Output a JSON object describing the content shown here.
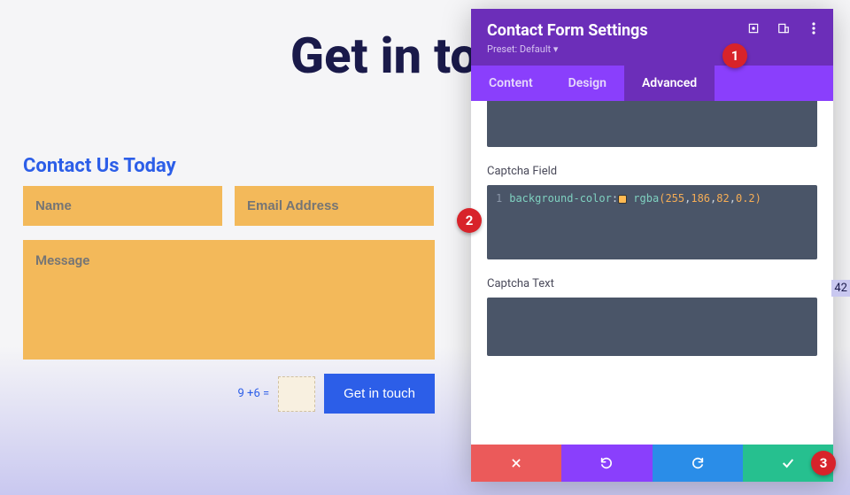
{
  "page": {
    "title": "Get in touch",
    "contact_heading": "Contact Us Today",
    "fields": {
      "name_placeholder": "Name",
      "email_placeholder": "Email Address",
      "message_placeholder": "Message"
    },
    "captcha": {
      "label": "9 +6 ="
    },
    "submit_label": "Get in touch"
  },
  "panel": {
    "title": "Contact Form Settings",
    "preset": "Preset: Default ▾",
    "tabs": {
      "content": "Content",
      "design": "Design",
      "advanced": "Advanced"
    },
    "sections": {
      "captcha_field": "Captcha Field",
      "captcha_text": "Captcha Text"
    },
    "code": {
      "line_no": "1",
      "property": "background-color",
      "func": "rgba",
      "args": [
        "255",
        "186",
        "82",
        "0.2"
      ]
    },
    "icons": {
      "expand": "expand-icon",
      "help": "help-icon",
      "menu": "menu-icon"
    }
  },
  "actions": {
    "cancel": "✕",
    "undo": "↺",
    "redo": "↻",
    "save": "✓"
  },
  "badges": {
    "one": "1",
    "two": "2",
    "three": "3"
  },
  "side_marker": "42",
  "colors": {
    "accent_purple": "#6c2eb9",
    "accent_purple_light": "#8a3ffc",
    "field_bg": "#f3b95a",
    "submit": "#2c5ee8"
  }
}
